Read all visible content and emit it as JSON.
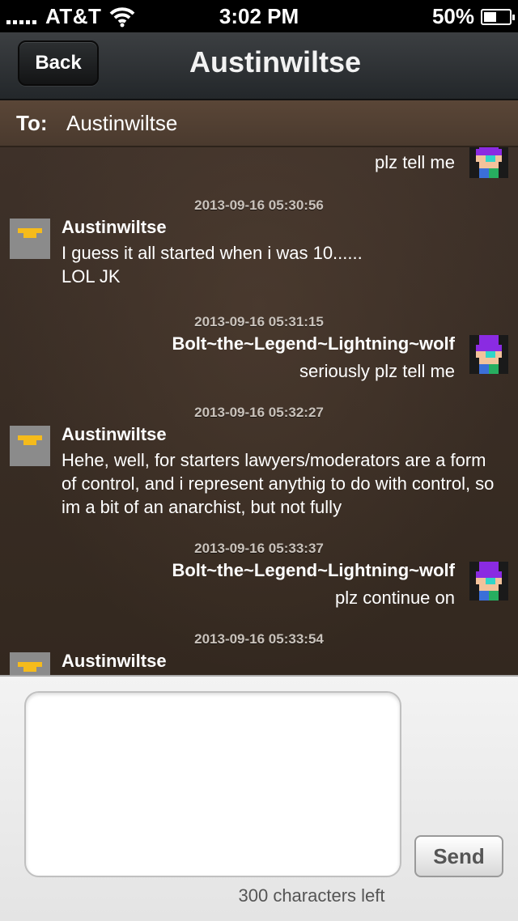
{
  "status_bar": {
    "carrier": "AT&T",
    "time": "3:02 PM",
    "battery": "50%",
    "battery_level": 0.5,
    "icons": [
      "signal-icon",
      "wifi-icon",
      "battery-charging-icon"
    ]
  },
  "nav": {
    "back_label": "Back",
    "title": "Austinwiltse"
  },
  "to_bar": {
    "label": "To:",
    "value": "Austinwiltse"
  },
  "messages": [
    {
      "side": "right",
      "sender": "",
      "text": "plz tell me",
      "timestamp": ""
    },
    {
      "side": "left",
      "timestamp": "2013-09-16 05:30:56",
      "sender": "Austinwiltse",
      "text": "I guess it all started when i was 10......\nLOL JK"
    },
    {
      "side": "right",
      "timestamp": "2013-09-16 05:31:15",
      "sender": "Bolt~the~Legend~Lightning~wolf",
      "text": "seriously plz tell me"
    },
    {
      "side": "left",
      "timestamp": "2013-09-16 05:32:27",
      "sender": "Austinwiltse",
      "text": "Hehe, well, for starters lawyers/moderators are a form of control, and i represent anythig to do with control, so im a bit of an anarchist, but not fully"
    },
    {
      "side": "right",
      "timestamp": "2013-09-16 05:33:37",
      "sender": "Bolt~the~Legend~Lightning~wolf",
      "text": "plz continue on"
    },
    {
      "side": "left",
      "timestamp": "2013-09-16 05:33:54",
      "sender": "Austinwiltse",
      "text": ""
    }
  ],
  "compose": {
    "input_value": "",
    "send_label": "Send",
    "chars_left": "300 characters left"
  }
}
